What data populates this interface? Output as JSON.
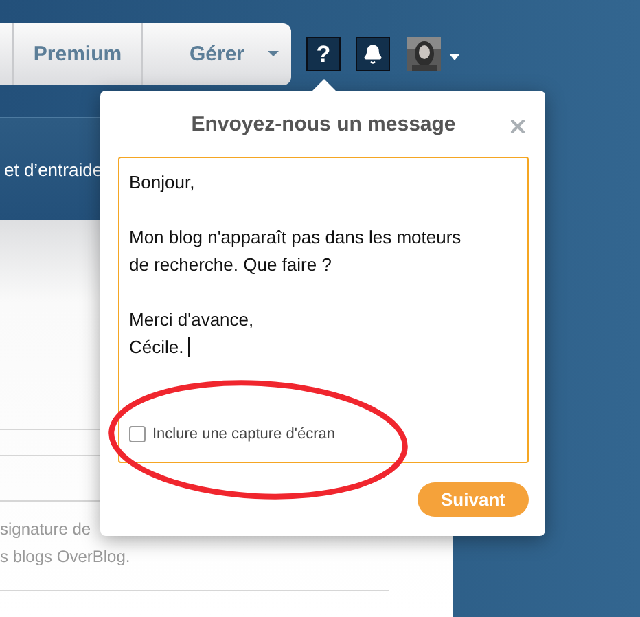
{
  "nav": {
    "tabs": [
      {
        "label": "Premium",
        "kind": "plain"
      },
      {
        "label": "Gérer",
        "kind": "dropdown"
      }
    ],
    "help": "?"
  },
  "page": {
    "banner_text": "et d’entraide",
    "lines": [
      "signature de",
      "s blogs OverBlog."
    ]
  },
  "dialog": {
    "title": "Envoyez-nous un message",
    "message": [
      [
        "Bonjour,"
      ],
      [
        "Mon blog n'apparaît pas dans les moteurs",
        "de recherche. Que faire ?"
      ],
      [
        "Merci d'avance,",
        "Cécile."
      ]
    ],
    "screenshot_option": {
      "label": "Inclure une capture d'écran",
      "checked": false
    },
    "submit": "Suivant"
  }
}
